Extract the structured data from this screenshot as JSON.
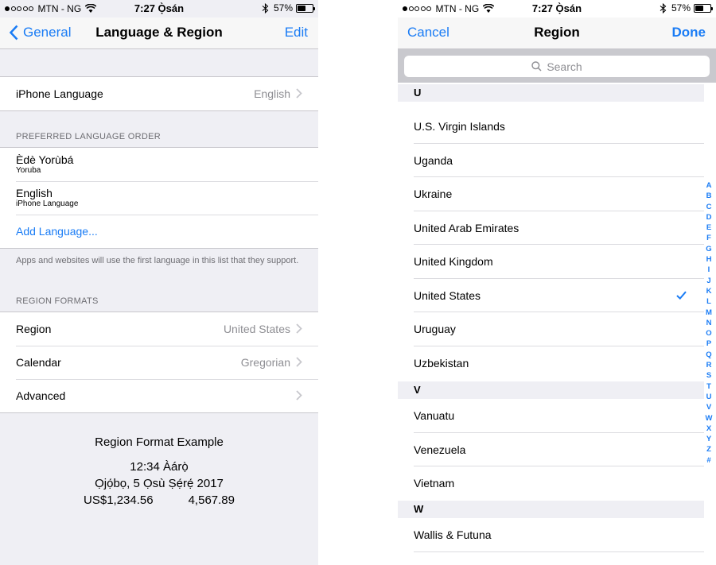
{
  "status": {
    "carrier": "MTN - NG",
    "time": "7:27 Ọ̀sán",
    "battery": "57%",
    "battery_level": 0.57
  },
  "left": {
    "nav": {
      "back_label": "General",
      "title": "Language & Region",
      "edit_label": "Edit"
    },
    "iphone_language": {
      "label": "iPhone Language",
      "value": "English"
    },
    "preferred_header": "PREFERRED LANGUAGE ORDER",
    "languages": [
      {
        "name": "Èdè Yorùbá",
        "sub": "Yoruba"
      },
      {
        "name": "English",
        "sub": "iPhone Language"
      }
    ],
    "add_language": "Add Language...",
    "languages_footer": "Apps and websites will use the first language in this list that they support.",
    "region_header": "REGION FORMATS",
    "region_rows": [
      {
        "label": "Region",
        "value": "United States"
      },
      {
        "label": "Calendar",
        "value": "Gregorian"
      },
      {
        "label": "Advanced",
        "value": ""
      }
    ],
    "example": {
      "title": "Region Format Example",
      "time": "12:34 Àárọ̀",
      "date": "Ọjọ́bọ, 5 Ọsù Ṣẹ́rẹ́ 2017",
      "currency": "US$1,234.56",
      "number": "4,567.89"
    }
  },
  "right": {
    "nav": {
      "cancel_label": "Cancel",
      "title": "Region",
      "done_label": "Done"
    },
    "search_placeholder": "Search",
    "sections": [
      {
        "letter": "U",
        "items": [
          "U.S. Virgin Islands",
          "Uganda",
          "Ukraine",
          "United Arab Emirates",
          "United Kingdom",
          "United States",
          "Uruguay",
          "Uzbekistan"
        ]
      },
      {
        "letter": "V",
        "items": [
          "Vanuatu",
          "Venezuela",
          "Vietnam"
        ]
      },
      {
        "letter": "W",
        "items": [
          "Wallis & Futuna"
        ]
      }
    ],
    "selected": "United States",
    "index_letters": [
      "A",
      "B",
      "C",
      "D",
      "E",
      "F",
      "G",
      "H",
      "I",
      "J",
      "K",
      "L",
      "M",
      "N",
      "O",
      "P",
      "Q",
      "R",
      "S",
      "T",
      "U",
      "V",
      "W",
      "X",
      "Y",
      "Z",
      "#"
    ]
  },
  "colors": {
    "accent": "#1a7cf5",
    "background": "#efeff4",
    "secondary_text": "#8e8e93"
  }
}
